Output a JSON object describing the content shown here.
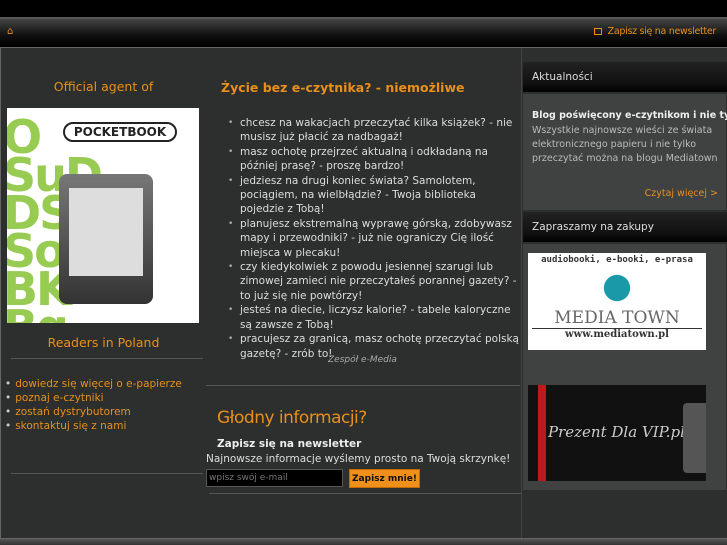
{
  "nav": {
    "home_icon": "home-icon",
    "newsletter_icon": "envelope-icon",
    "newsletter_link": "Zapisz się na newsletter"
  },
  "left": {
    "agent_title": "Official agent of",
    "banner_logo": "POCKETBOOK",
    "readers_title": "Readers in Poland",
    "links": [
      "dowiedz się więcej o e-papierze",
      "poznaj e-czytniki",
      "zostań dystrybutorem",
      "skontaktuj się z nami"
    ]
  },
  "center": {
    "title": "Życie  bez  e-czytnika? - niemożliwe",
    "bullets": [
      "chcesz na wakacjach przeczytać kilka książek? - nie musisz już płacić za nadbagaż!",
      "masz ochotę przejrzeć aktualną i odkładaną na później prasę? - proszę bardzo!",
      "jedziesz na drugi koniec świata? Samolotem, pociągiem, na wielbłądzie? - Twoja biblioteka pojedzie z Tobą!",
      "planujesz ekstremalną wyprawę górską, zdobywasz mapy i przewodniki? - już nie ograniczy Cię ilość miejsca w plecaku!",
      "czy kiedykolwiek z powodu jesiennej szarugi lub zimowej zamieci nie przeczytałeś porannej gazety? - to już się nie powtórzy!",
      "jesteś na diecie, liczysz kalorie? - tabele kaloryczne są zawsze z Tobą!",
      "pracujesz za granicą, masz ochotę przeczytać polską gazetę? - zrób to!"
    ],
    "signature": "Zespół e-Media",
    "newsletter": {
      "heading": "Głodny informacji?",
      "subheading": "Zapisz się na newsletter",
      "text": "Najnowsze informacje wyślemy  prosto na Twoją skrzynkę!",
      "email_placeholder": "wpisz swój e-mail",
      "submit": "Zapisz mnie!"
    }
  },
  "right": {
    "news_header": "Aktualności",
    "blog_title": "Blog poświęcony e-czytnikom i nie tylko",
    "blog_text": "Wszystkie najnowsze wieści ze świata elektronicznego papieru i nie tylko przeczytać można na blogu Mediatown",
    "read_more": "Czytaj więcej >",
    "shop_header": "Zapraszamy na zakupy",
    "mediatown": {
      "tagline": "audiobooki, e-booki, e-prasa",
      "name": "MEDIA TOWN",
      "url": "www.mediatown.pl"
    },
    "vip": "Prezent Dla VIP.pl"
  },
  "colors": {
    "accent": "#e8901a",
    "background": "#2d2e2e"
  }
}
